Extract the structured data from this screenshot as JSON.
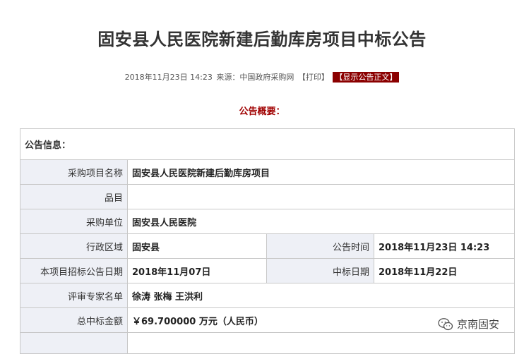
{
  "article": {
    "title": "固安县人民医院新建后勤库房项目中标公告",
    "date": "2018年11月23日 14:23",
    "source": "来源：中国政府采购网",
    "print_label": "【打印】",
    "show_label": "【显示公告正文】",
    "summary_heading": "公告概要："
  },
  "table": {
    "section_title": "公告信息：",
    "project_name_label": "采购项目名称",
    "project_name": "固安县人民医院新建后勤库房项目",
    "category_label": "品目",
    "category": "",
    "purchaser_label": "采购单位",
    "purchaser": "固安县人民医院",
    "region_label": "行政区域",
    "region": "固安县",
    "announce_time_label": "公告时间",
    "announce_time": "2018年11月23日 14:23",
    "bid_date_label": "本项目招标公告日期",
    "bid_date": "2018年11月07日",
    "award_date_label": "中标日期",
    "award_date": "2018年11月22日",
    "experts_label": "评审专家名单",
    "experts": "徐涛 张梅 王洪利",
    "amount_label": "总中标金额",
    "amount": "￥69.700000 万元（人民币）"
  },
  "watermark": {
    "text": "京南固安",
    "icon": "wechat-icon"
  }
}
